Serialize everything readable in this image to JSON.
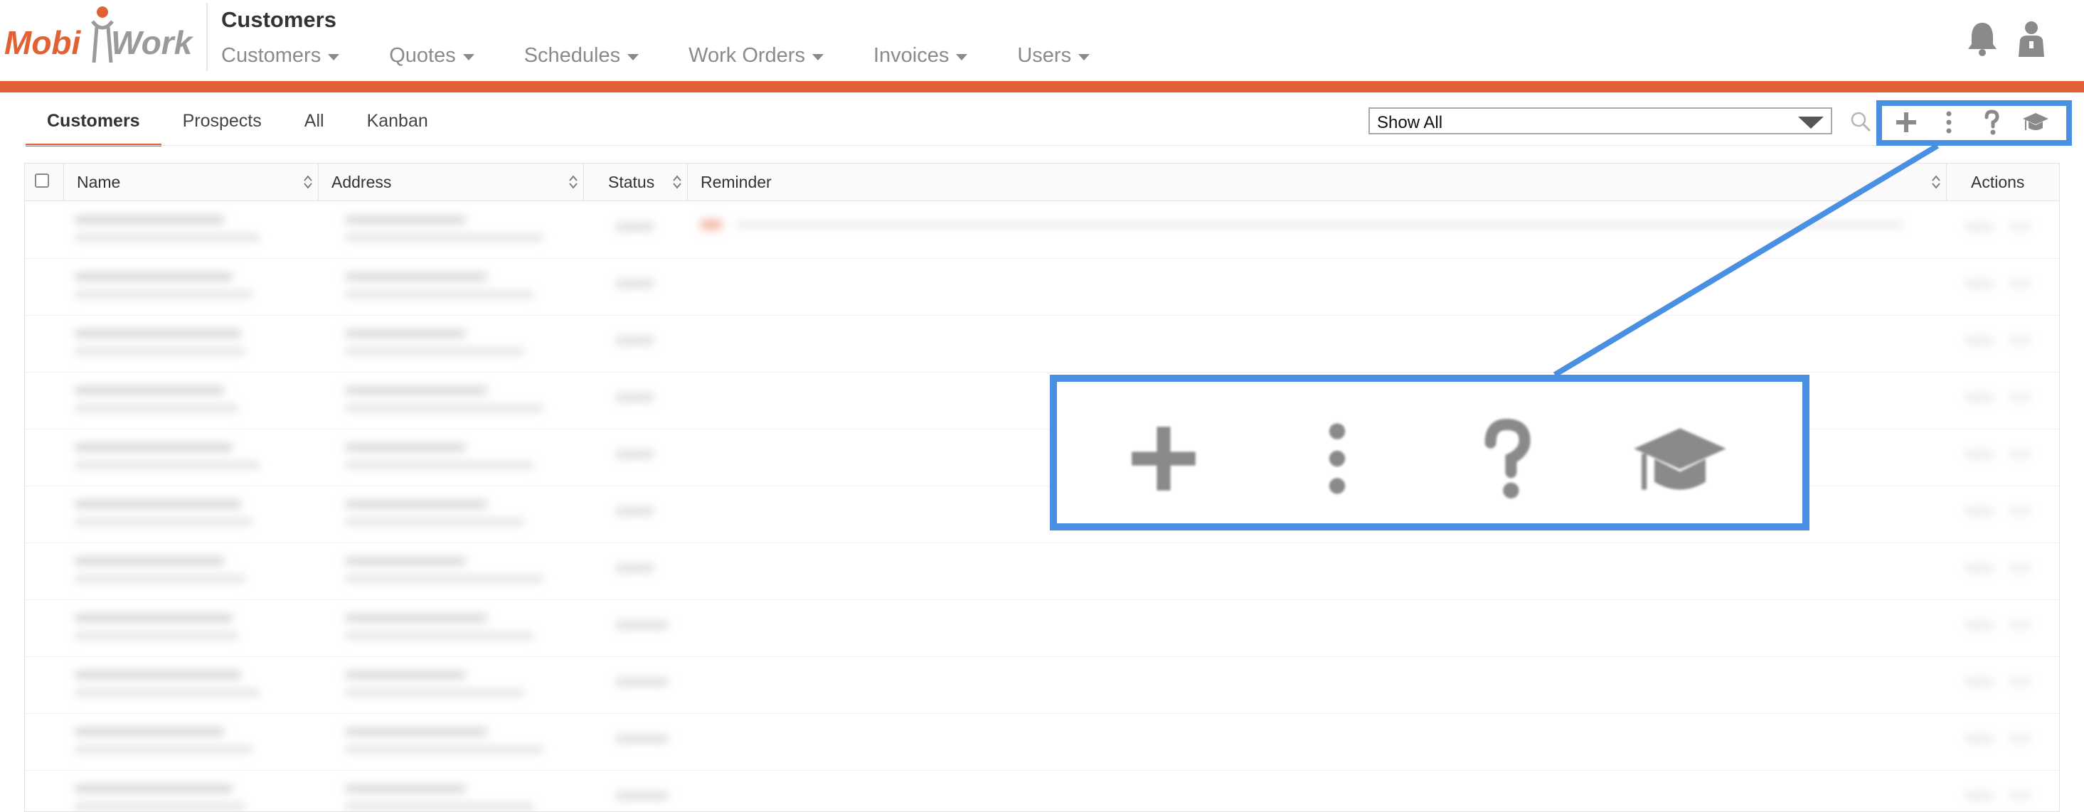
{
  "header": {
    "logo_text": "MobiWork",
    "page_title": "Customers",
    "nav": [
      {
        "label": "Customers"
      },
      {
        "label": "Quotes"
      },
      {
        "label": "Schedules"
      },
      {
        "label": "Work Orders"
      },
      {
        "label": "Invoices"
      },
      {
        "label": "Users"
      }
    ],
    "icons": [
      "bell-icon",
      "user-icon"
    ]
  },
  "tabs": [
    {
      "label": "Customers",
      "active": true
    },
    {
      "label": "Prospects",
      "active": false
    },
    {
      "label": "All",
      "active": false
    },
    {
      "label": "Kanban",
      "active": false
    }
  ],
  "filter": {
    "selected": "Show All"
  },
  "toolbar": {
    "icons": [
      "plus-icon",
      "more-vertical-icon",
      "help-icon",
      "graduation-cap-icon"
    ]
  },
  "table": {
    "columns": [
      "Name",
      "Address",
      "Status",
      "Reminder",
      "Actions"
    ]
  },
  "colors": {
    "accent": "#e06234",
    "highlight": "#4a90e2",
    "icon_gray": "#8a8a8a"
  }
}
